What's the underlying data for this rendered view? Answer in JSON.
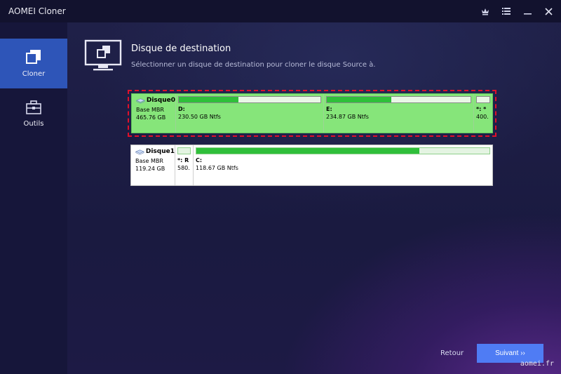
{
  "window": {
    "title": "AOMEI Cloner"
  },
  "titlebar": {
    "icons": [
      "crown-icon",
      "menu-icon",
      "minimize-icon",
      "close-icon"
    ]
  },
  "sidebar": {
    "items": [
      {
        "label": "Cloner",
        "icon": "clone-icon",
        "active": true
      },
      {
        "label": "Outils",
        "icon": "toolbox-icon",
        "active": false
      }
    ]
  },
  "header": {
    "title": "Disque de destination",
    "subtitle": "Sélectionner un disque de destination pour cloner le disque Source à."
  },
  "disks": [
    {
      "name": "Disque0",
      "type": "Base MBR",
      "size": "465.76 GB",
      "selected": true,
      "partitions": [
        {
          "letter": "D:",
          "info": "230.50 GB Ntfs",
          "used": 0.42
        },
        {
          "letter": "E:",
          "info": "234.87 GB Ntfs",
          "used": 0.45
        },
        {
          "letter": "*: *",
          "info": "400.",
          "used": 0
        }
      ]
    },
    {
      "name": "Disque1",
      "type": "Base MBR",
      "size": "119.24 GB",
      "selected": false,
      "partitions": [
        {
          "letter": "*: R",
          "info": "580.",
          "used": 0
        },
        {
          "letter": "C:",
          "info": "118.67 GB Ntfs",
          "used": 0.76
        }
      ]
    }
  ],
  "footer": {
    "back_label": "Retour",
    "next_label": "Suivant ››"
  },
  "watermark": "aomei.fr",
  "colors": {
    "accent": "#4f7cf4",
    "sidebar_active": "#2e55b8",
    "selected_disk": "#86e57a",
    "selection_border": "#e0102a",
    "used_fill": "#2fbf3a"
  }
}
